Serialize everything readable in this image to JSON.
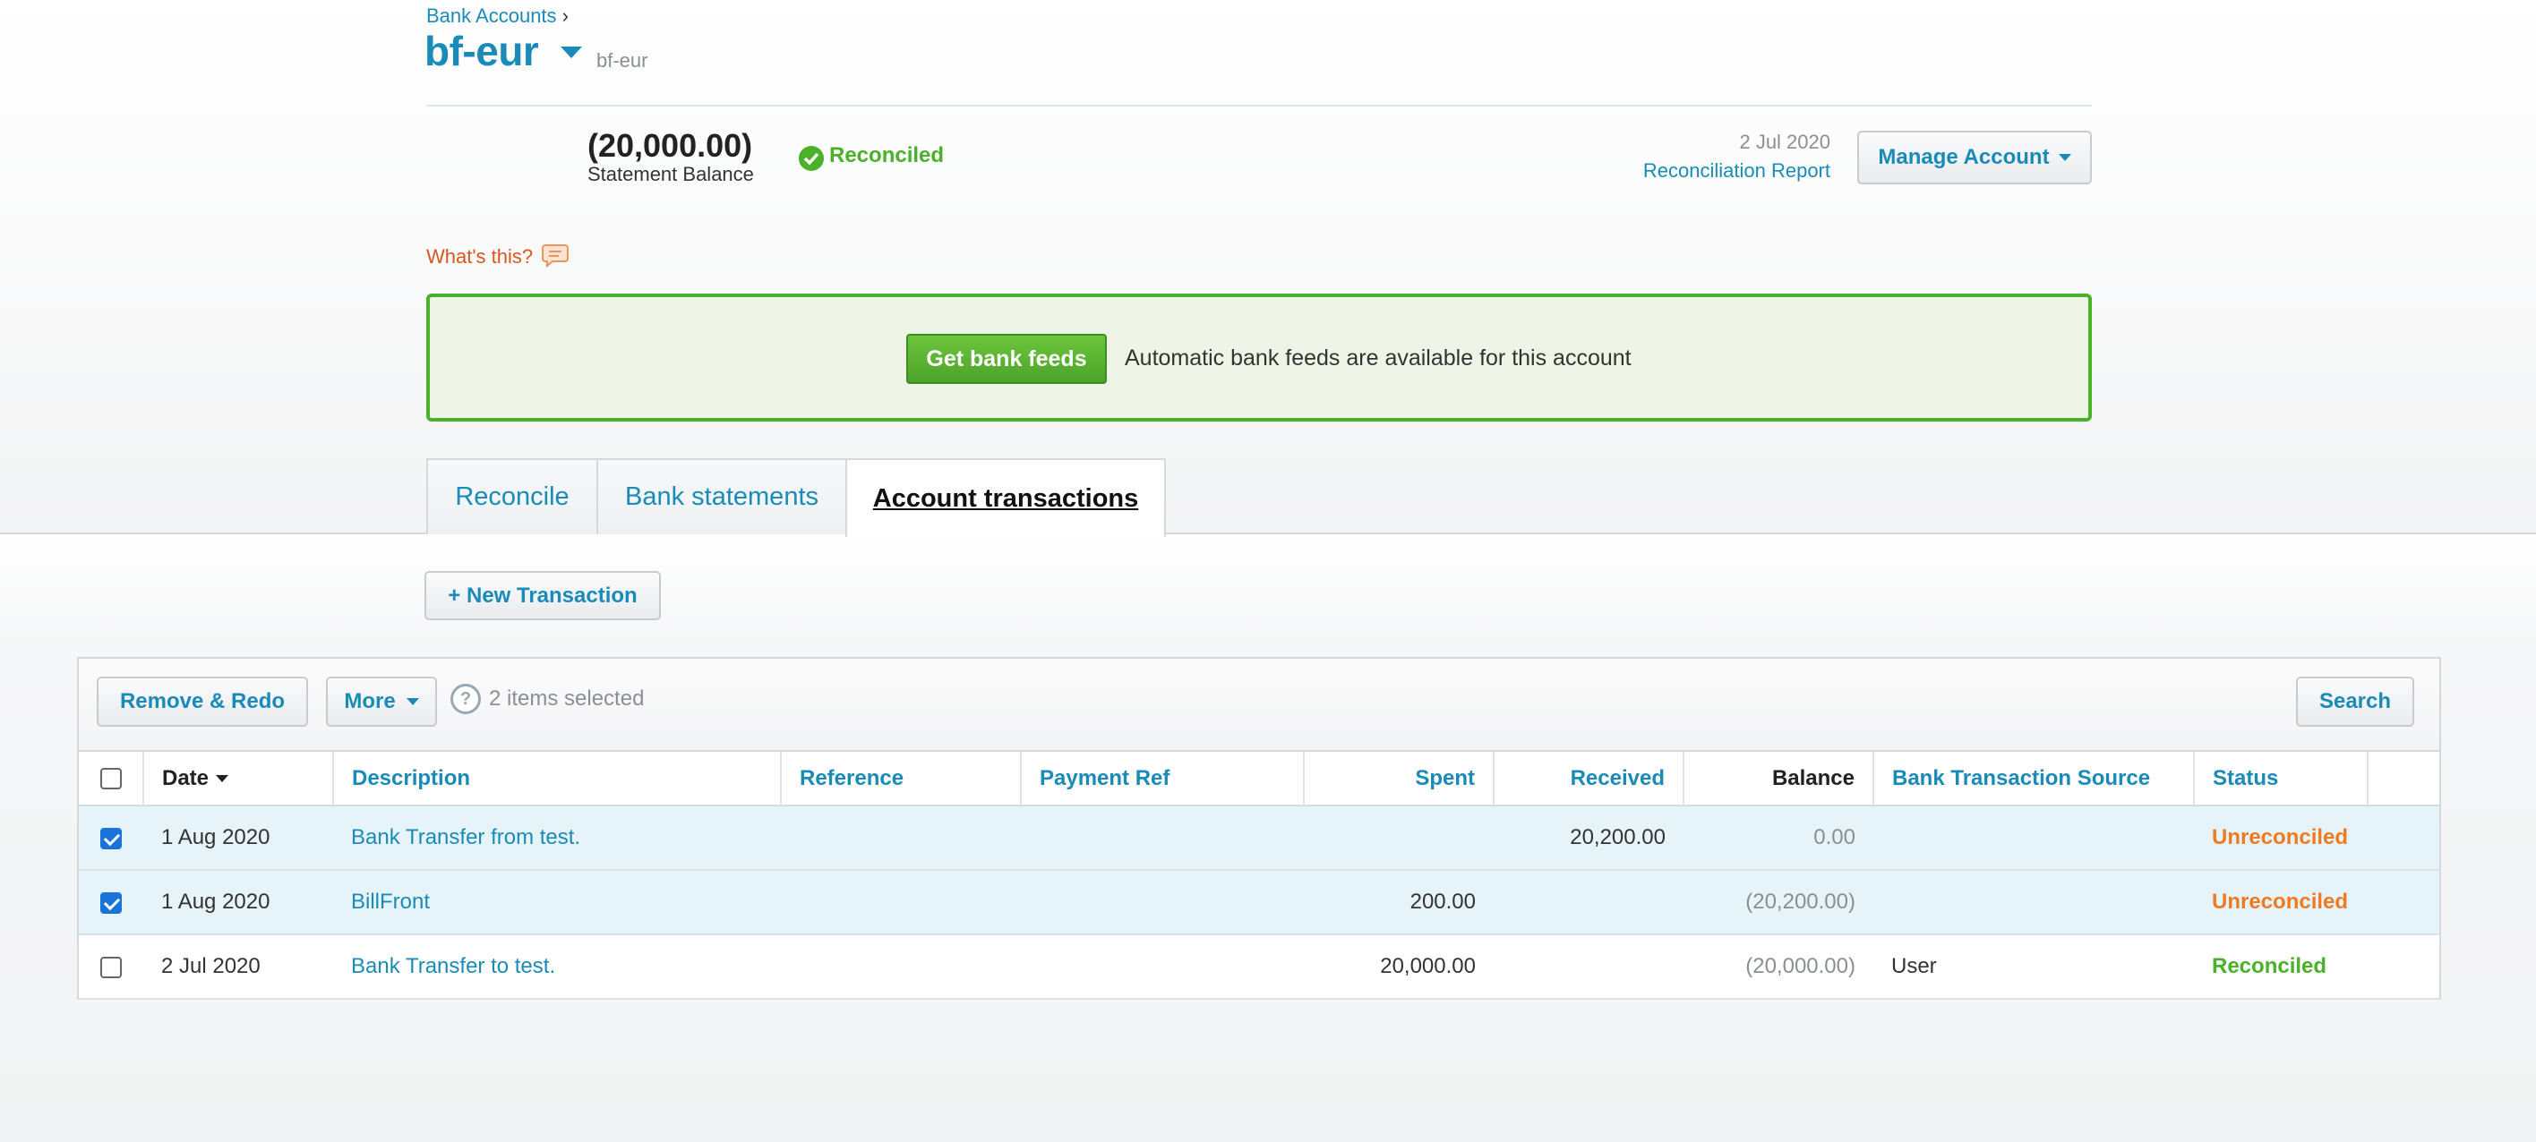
{
  "breadcrumb": {
    "label": "Bank Accounts",
    "sep": "›"
  },
  "account": {
    "name": "bf-eur",
    "code": "bf-eur"
  },
  "statement": {
    "amount": "(20,000.00)",
    "label": "Statement Balance",
    "status": "Reconciled"
  },
  "report": {
    "date": "2 Jul 2020",
    "link": "Reconciliation Report"
  },
  "manage_button": "Manage Account",
  "whats_this": "What's this?",
  "bank_feed": {
    "button": "Get bank feeds",
    "text": "Automatic bank feeds are available for this account"
  },
  "tabs": [
    {
      "label": "Reconcile"
    },
    {
      "label": "Bank statements"
    },
    {
      "label": "Account transactions"
    }
  ],
  "new_transaction": "+ New Transaction",
  "toolbar": {
    "remove": "Remove & Redo",
    "more": "More",
    "help": "?",
    "selected": "2 items selected",
    "search": "Search"
  },
  "columns": [
    "Date",
    "Description",
    "Reference",
    "Payment Ref",
    "Spent",
    "Received",
    "Balance",
    "Bank Transaction Source",
    "Status"
  ],
  "rows": [
    {
      "checked": true,
      "date": "1 Aug 2020",
      "description": "Bank Transfer from test.",
      "reference": "",
      "payment_ref": "",
      "spent": "",
      "received": "20,200.00",
      "balance": "0.00",
      "source": "",
      "status": "Unreconciled"
    },
    {
      "checked": true,
      "date": "1 Aug 2020",
      "description": "BillFront",
      "reference": "",
      "payment_ref": "",
      "spent": "200.00",
      "received": "",
      "balance": "(20,200.00)",
      "source": "",
      "status": "Unreconciled"
    },
    {
      "checked": false,
      "date": "2 Jul 2020",
      "description": "Bank Transfer to test.",
      "reference": "",
      "payment_ref": "",
      "spent": "20,000.00",
      "received": "",
      "balance": "(20,000.00)",
      "source": "User",
      "status": "Reconciled"
    }
  ],
  "colors": {
    "accent": "#1a8bb9",
    "success": "#4bb02a",
    "warning": "#ee7a22",
    "help": "#d9561f"
  }
}
